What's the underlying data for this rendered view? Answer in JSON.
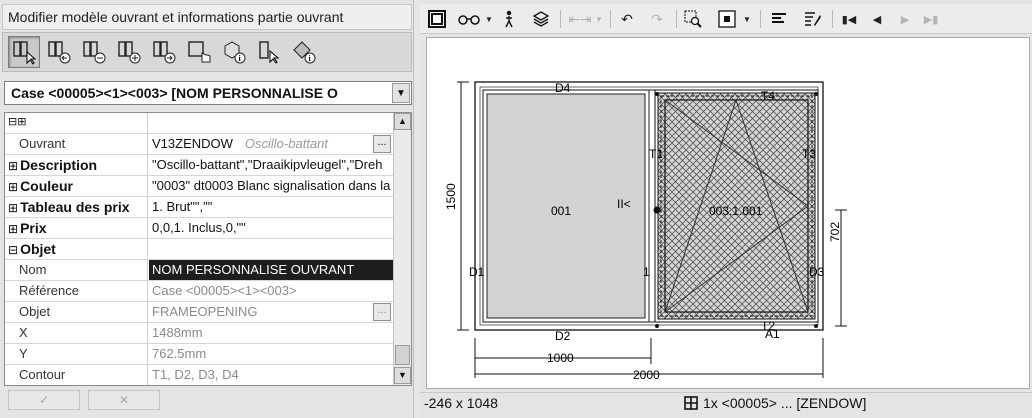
{
  "panel": {
    "title": "Modifier modèle ouvrant et informations partie ouvrant",
    "case_label": "Case <00005><1><003> [NOM PERSONNALISE O",
    "ok_label": "✓",
    "cancel_label": "✕"
  },
  "grid": {
    "header_glyph": "⊟⊞",
    "rows": [
      {
        "name": "Ouvrant",
        "value": "V13ZENDOW",
        "sub": "Oscillo-battant",
        "type": "prop",
        "ellipsis": true
      },
      {
        "name": "Description",
        "value": "\"Oscillo-battant\",\"Draaikipvleugel\",\"Dreh",
        "type": "cat",
        "expander": "⊞"
      },
      {
        "name": "Couleur",
        "value": "\"0003\" dt0003 Blanc signalisation dans la",
        "type": "cat",
        "expander": "⊞"
      },
      {
        "name": "Tableau des prix",
        "value": "1. Brut\"\",\"\"",
        "type": "cat",
        "expander": "⊞"
      },
      {
        "name": "Prix",
        "value": "0,0,1. Inclus,0,\"\"",
        "type": "cat",
        "expander": "⊞"
      },
      {
        "name": "Objet",
        "value": "",
        "type": "cat",
        "expander": "⊟"
      },
      {
        "name": "Nom",
        "value": "NOM PERSONNALISE OUVRANT",
        "type": "prop",
        "selected": true
      },
      {
        "name": "Référence",
        "value": "Case <00005><1><003>",
        "type": "prop",
        "dim": true
      },
      {
        "name": "Objet",
        "value": "FRAMEOPENING",
        "type": "prop",
        "dim": true,
        "ellipsis": true
      },
      {
        "name": "X",
        "value": "1488mm",
        "type": "prop",
        "dim": true
      },
      {
        "name": "Y",
        "value": "762.5mm",
        "type": "prop",
        "dim": true
      },
      {
        "name": "Contour",
        "value": "T1, D2, D3, D4",
        "type": "prop",
        "dim": true
      }
    ]
  },
  "drawing": {
    "labels": {
      "d4": "D4",
      "d1": "D1",
      "d2": "D2",
      "d3": "D3",
      "t4": "T4",
      "t1": "T1",
      "t2": "T2",
      "t3": "T3",
      "a1": "A1",
      "one": "1",
      "ii": "II<",
      "left_pane": "001",
      "right_pane": "003.1.001",
      "dim_height": "1500",
      "dim_sash_height": "702",
      "dim_sash_width": "1000",
      "dim_total_width": "2000"
    }
  },
  "status": {
    "coords": "-246 x 1048",
    "selection": "1x <00005> ... [ZENDOW]"
  }
}
